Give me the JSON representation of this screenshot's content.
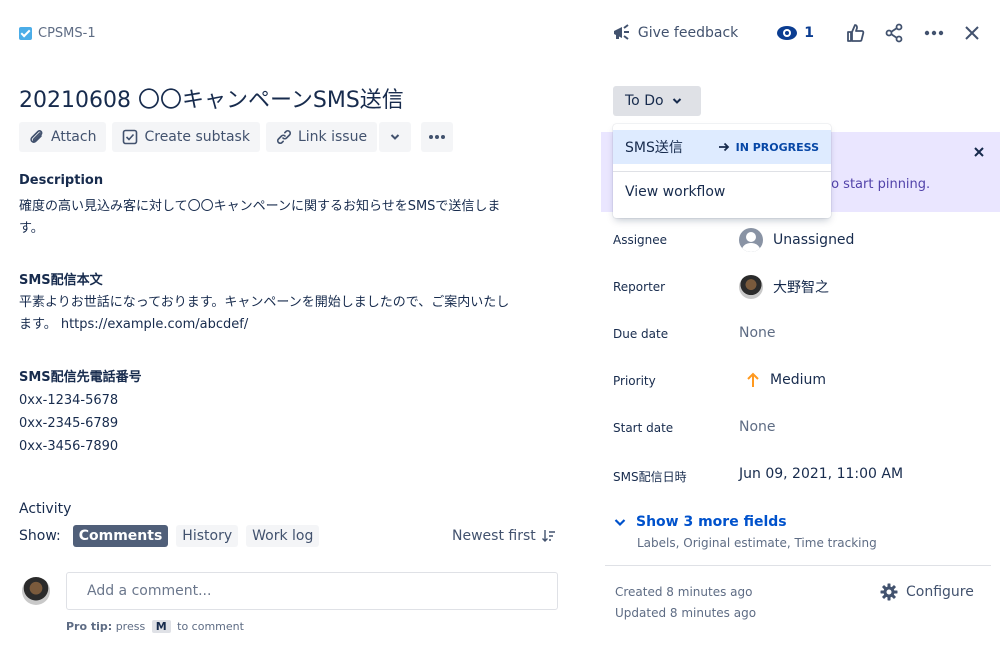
{
  "header": {
    "issue_key": "CPSMS-1",
    "give_feedback": "Give feedback",
    "watch_count": "1"
  },
  "issue": {
    "title": "20210608 〇〇キャンペーンSMS送信"
  },
  "toolbar": {
    "attach": "Attach",
    "create_subtask": "Create subtask",
    "link_issue": "Link issue"
  },
  "description": {
    "label": "Description",
    "line1": "確度の高い見込み客に対して〇〇キャンペーンに関するお知らせをSMSで送信しま",
    "line2": "す。",
    "body_label": "SMS配信本文",
    "body_line1": "平素よりお世話になっております。キャンペーンを開始しましたので、ご案内いたし",
    "body_line2": "ます。 https://example.com/abcdef/",
    "phones_label": "SMS配信先電話番号",
    "phones": [
      "0xx-1234-5678",
      "0xx-2345-6789",
      "0xx-3456-7890"
    ]
  },
  "activity": {
    "label": "Activity",
    "show_label": "Show:",
    "tabs": [
      "Comments",
      "History",
      "Work log"
    ],
    "active_tab": "Comments",
    "sort": "Newest first",
    "comment_placeholder": "Add a comment...",
    "protip_prefix": "Pro tip:",
    "protip_press": "press",
    "protip_key": "M",
    "protip_suffix": "to comment"
  },
  "status": {
    "current": "To Do",
    "dropdown": {
      "transition_name": "SMS送信",
      "transition_target": "IN PROGRESS",
      "view_workflow": "View workflow"
    },
    "pin_banner_text": "to start pinning."
  },
  "fields": [
    {
      "label": "Assignee",
      "value": "Unassigned",
      "kind": "unassigned"
    },
    {
      "label": "Reporter",
      "value": "大野智之",
      "kind": "user"
    },
    {
      "label": "Due date",
      "value": "None",
      "kind": "none"
    },
    {
      "label": "Priority",
      "value": "Medium",
      "kind": "priority"
    },
    {
      "label": "Start date",
      "value": "None",
      "kind": "none"
    },
    {
      "label": "SMS配信日時",
      "value": "Jun 09, 2021, 11:00 AM",
      "kind": "text"
    }
  ],
  "more_fields": {
    "label": "Show 3 more fields",
    "sub": "Labels, Original estimate, Time tracking"
  },
  "meta": {
    "created": "Created 8 minutes ago",
    "updated": "Updated 8 minutes ago",
    "configure": "Configure"
  },
  "colors": {
    "primary": "#0052cc",
    "priority_medium": "#ff991f",
    "pin_banner": "#eae6ff"
  }
}
